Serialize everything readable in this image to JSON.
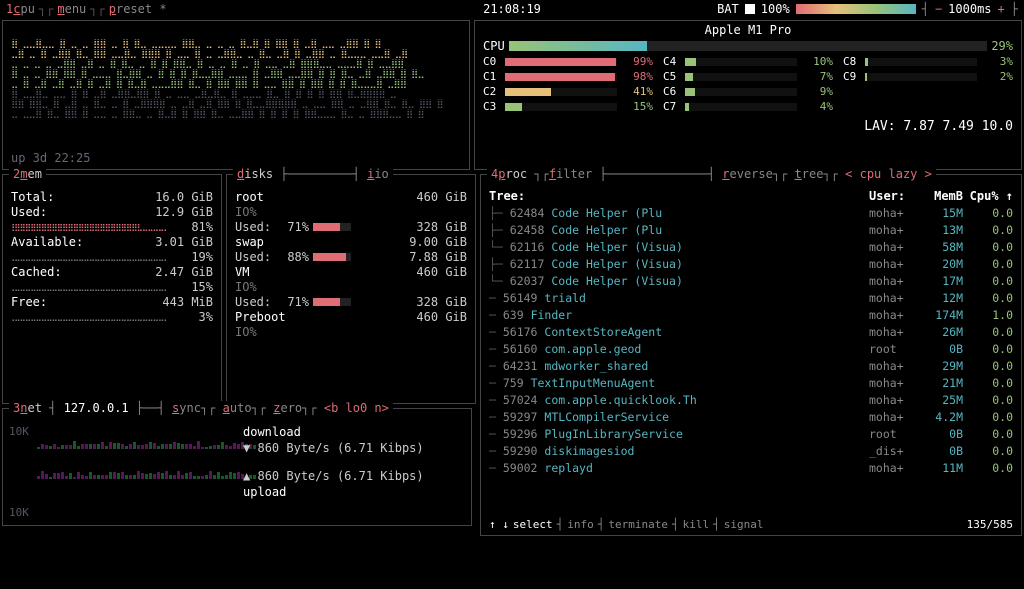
{
  "top": {
    "tabs": [
      "cpu",
      "menu",
      "preset *"
    ],
    "clock": "21:08:19",
    "bat_label": "BAT",
    "bat_pct": "100%",
    "interval": "1000ms",
    "minus": "−",
    "plus": "+"
  },
  "cpu_panel": {
    "uptime": "up 3d 22:25"
  },
  "cores": {
    "chip": "Apple M1 Pro",
    "agg_label": "CPU",
    "agg_pct": "29%",
    "agg_fill": 29,
    "list": [
      {
        "name": "C0",
        "pct": "99%",
        "fill": 99,
        "color": "#e06c75"
      },
      {
        "name": "C1",
        "pct": "98%",
        "fill": 98,
        "color": "#e06c75"
      },
      {
        "name": "C2",
        "pct": "41%",
        "fill": 41,
        "color": "#e5c07b"
      },
      {
        "name": "C3",
        "pct": "15%",
        "fill": 15,
        "color": "#98c379"
      },
      {
        "name": "C4",
        "pct": "10%",
        "fill": 10,
        "color": "#98c379"
      },
      {
        "name": "C5",
        "pct": "7%",
        "fill": 7,
        "color": "#98c379"
      },
      {
        "name": "C6",
        "pct": "9%",
        "fill": 9,
        "color": "#98c379"
      },
      {
        "name": "C7",
        "pct": "4%",
        "fill": 4,
        "color": "#98c379"
      },
      {
        "name": "C8",
        "pct": "3%",
        "fill": 3,
        "color": "#98c379"
      },
      {
        "name": "C9",
        "pct": "2%",
        "fill": 2,
        "color": "#98c379"
      }
    ],
    "lav_label": "LAV:",
    "lav": "7.87 7.49 10.0"
  },
  "mem": {
    "total_k": "Total:",
    "total_v": "16.0 GiB",
    "used_k": "Used:",
    "used_v": "12.9 GiB",
    "used_pct": "81%",
    "avail_k": "Available:",
    "avail_v": "3.01 GiB",
    "avail_pct": "19%",
    "cached_k": "Cached:",
    "cached_v": "2.47 GiB",
    "cached_pct": "15%",
    "free_k": "Free:",
    "free_v": "443 MiB",
    "free_pct": "3%"
  },
  "disks": {
    "io_label": "io",
    "items": [
      {
        "name": "root",
        "size": "460 GiB",
        "io": "IO%",
        "used_pct": "71%",
        "used_fill": 71,
        "used_size": "328 GiB"
      },
      {
        "name": "swap",
        "size": "9.00 GiB",
        "io": "",
        "used_pct": "88%",
        "used_fill": 88,
        "used_size": "7.88 GiB"
      },
      {
        "name": "VM",
        "size": "460 GiB",
        "io": "IO%",
        "used_pct": "71%",
        "used_fill": 71,
        "used_size": "328 GiB"
      },
      {
        "name": "Preboot",
        "size": "460 GiB",
        "io": "IO%",
        "used_pct": "",
        "used_fill": 0,
        "used_size": ""
      }
    ],
    "used_label": "Used:"
  },
  "net": {
    "addr": "127.0.0.1",
    "scale": "10K",
    "tabs": [
      "sync",
      "auto",
      "zero"
    ],
    "iface": "<b lo0 n>",
    "download_label": "download",
    "upload_label": "upload",
    "down_val": "860 Byte/s (6.71 Kibps)",
    "up_val": "860 Byte/s (6.71 Kibps)",
    "down_arrow": "▼",
    "up_arrow": "▲"
  },
  "proc": {
    "tabs": [
      "proc",
      "filter",
      "reverse",
      "tree"
    ],
    "sort": "< cpu lazy >",
    "head": {
      "tree": "Tree:",
      "user": "User:",
      "mem": "MemB",
      "cpu": "Cpu% ↑"
    },
    "rows": [
      {
        "indent": 3,
        "branch": "├─",
        "pid": "62484",
        "name": "Code Helper (Plu",
        "user": "moha+",
        "mem": "15M",
        "cpu": "0.0"
      },
      {
        "indent": 3,
        "branch": "├─",
        "pid": "62458",
        "name": "Code Helper (Plu",
        "user": "moha+",
        "mem": "13M",
        "cpu": "0.0"
      },
      {
        "indent": 3,
        "branch": "└─",
        "pid": "62116",
        "name": "Code Helper (Visua)",
        "user": "moha+",
        "mem": "58M",
        "cpu": "0.0"
      },
      {
        "indent": 4,
        "branch": "├─",
        "pid": "62117",
        "name": "Code Helper (Visua)",
        "user": "moha+",
        "mem": "20M",
        "cpu": "0.0"
      },
      {
        "indent": 4,
        "branch": "└─",
        "pid": "62037",
        "name": "Code Helper (Visua)",
        "user": "moha+",
        "mem": "17M",
        "cpu": "0.0"
      },
      {
        "indent": 1,
        "branch": "─",
        "pid": "56149",
        "name": "triald",
        "user": "moha+",
        "mem": "12M",
        "cpu": "0.0"
      },
      {
        "indent": 1,
        "branch": "─",
        "pid": "639",
        "name": "Finder",
        "user": "moha+",
        "mem": "174M",
        "cpu": "1.0"
      },
      {
        "indent": 1,
        "branch": "─",
        "pid": "56176",
        "name": "ContextStoreAgent",
        "user": "moha+",
        "mem": "26M",
        "cpu": "0.0"
      },
      {
        "indent": 1,
        "branch": "─",
        "pid": "56160",
        "name": "com.apple.geod",
        "user": "root",
        "mem": "0B",
        "cpu": "0.0"
      },
      {
        "indent": 1,
        "branch": "─",
        "pid": "64231",
        "name": "mdworker_shared",
        "user": "moha+",
        "mem": "29M",
        "cpu": "0.0"
      },
      {
        "indent": 1,
        "branch": "─",
        "pid": "759",
        "name": "TextInputMenuAgent",
        "user": "moha+",
        "mem": "21M",
        "cpu": "0.0"
      },
      {
        "indent": 1,
        "branch": "─",
        "pid": "57024",
        "name": "com.apple.quicklook.Th",
        "user": "moha+",
        "mem": "25M",
        "cpu": "0.0"
      },
      {
        "indent": 1,
        "branch": "─",
        "pid": "59297",
        "name": "MTLCompilerService",
        "user": "moha+",
        "mem": "4.2M",
        "cpu": "0.0"
      },
      {
        "indent": 1,
        "branch": "─",
        "pid": "59296",
        "name": "PlugInLibraryService",
        "user": "root",
        "mem": "0B",
        "cpu": "0.0"
      },
      {
        "indent": 1,
        "branch": "─",
        "pid": "59290",
        "name": "diskimagesiod",
        "user": "_dis+",
        "mem": "0B",
        "cpu": "0.0"
      },
      {
        "indent": 1,
        "branch": "─",
        "pid": "59002",
        "name": "replayd",
        "user": "moha+",
        "mem": "11M",
        "cpu": "0.0"
      }
    ],
    "foot": {
      "arrows": "↑ ↓",
      "select": "select",
      "info": "info",
      "terminate": "terminate",
      "kill": "kill",
      "signal": "signal"
    },
    "pos": "135/585"
  },
  "labels": {
    "mem": "mem",
    "disks": "disks",
    "net": "net",
    "proc_num": "4"
  }
}
